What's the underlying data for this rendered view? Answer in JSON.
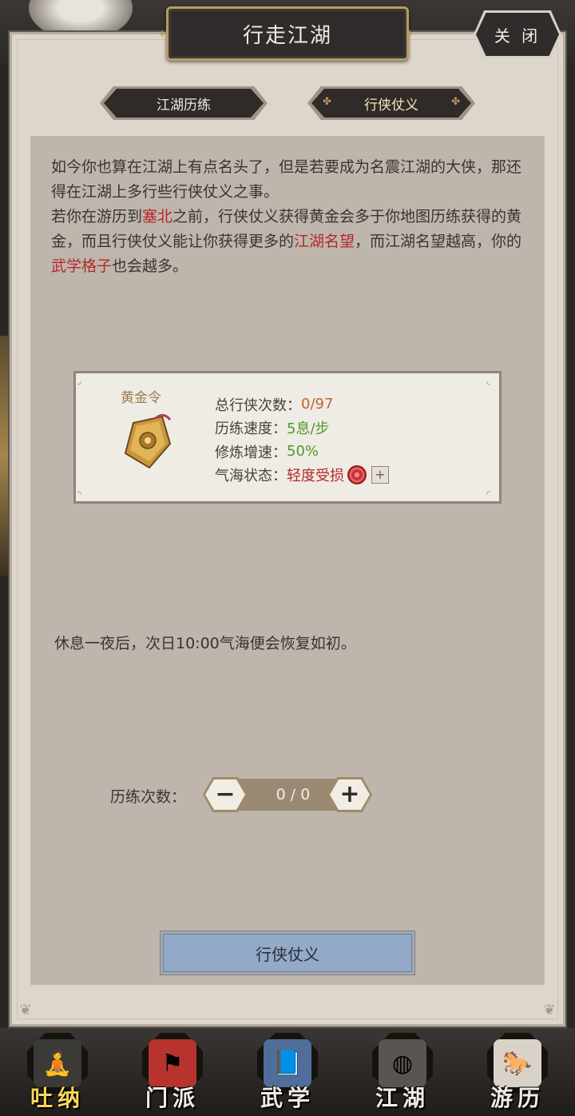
{
  "dialog": {
    "title": "行走江湖",
    "close_label": "关 闭"
  },
  "tabs": [
    {
      "label": "江湖历练",
      "active": false
    },
    {
      "label": "行侠仗义",
      "active": true
    }
  ],
  "description": {
    "line1": "如今你也算在江湖上有点名头了，但是若要成为名震江湖的大侠，那还得在江湖上多行些行侠仗义之事。",
    "p2_a": "若你在游历到",
    "p2_hl1": "塞北",
    "p2_b": "之前，行侠仗义获得黄金会多于你地图历练获得的黄金，而且行侠仗义能让你获得更多的",
    "p2_hl2": "江湖名望",
    "p2_c": "，而江湖名望越高，你的",
    "p2_hl3": "武学格子",
    "p2_d": "也会越多。"
  },
  "card": {
    "token_label": "黄金令",
    "token_icon": "gold-token-icon",
    "stats": [
      {
        "label": "总行侠次数：",
        "value": "0/97",
        "color": "#c0652d"
      },
      {
        "label": "历练速度：",
        "value": "5息/步",
        "color": "#4f9a2c"
      },
      {
        "label": "修炼增速：",
        "value": "50%",
        "color": "#4f9a2c"
      },
      {
        "label": "气海状态：",
        "value": "轻度受损",
        "color": "#b3282a"
      }
    ]
  },
  "rest_note": "休息一夜后，次日10:00气海便会恢复如初。",
  "stepper": {
    "label": "历练次数：",
    "value": "0 / 0",
    "minus": "−",
    "plus": "+"
  },
  "action_button": "行侠仗义",
  "bottom_nav": [
    {
      "label": "吐纳",
      "icon": "meditation-icon",
      "active": true
    },
    {
      "label": "门派",
      "icon": "sect-banner-icon",
      "active": false
    },
    {
      "label": "武学",
      "icon": "martial-book-icon",
      "active": false
    },
    {
      "label": "江湖",
      "icon": "bamboo-hat-icon",
      "active": false
    },
    {
      "label": "游历",
      "icon": "horse-icon",
      "active": false
    }
  ],
  "colors": {
    "panel_bg": "#ddd6cd",
    "content_bg": "#beb6ad",
    "highlight_red": "#b3282a",
    "action_blue": "#93a9c8"
  }
}
